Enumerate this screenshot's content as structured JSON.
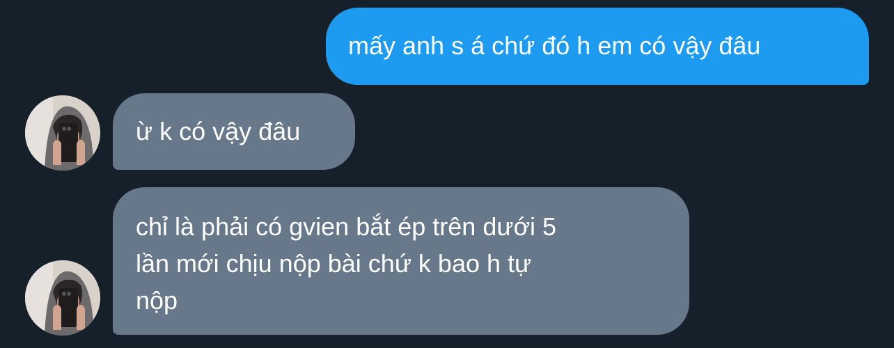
{
  "conversation": {
    "messages": [
      {
        "direction": "outgoing",
        "text": "mấy anh s á chứ đó h em có vậy đâu"
      },
      {
        "direction": "incoming",
        "text": "ừ k có vậy đâu"
      },
      {
        "direction": "incoming",
        "text": "chỉ là phải có gvien bắt ép trên dưới 5\nlần mới chịu nộp bài chứ k bao h tự\nnộp"
      }
    ]
  },
  "colors": {
    "background": "#15202b",
    "outgoing_bubble": "#1d9bf0",
    "incoming_bubble": "#66788a",
    "text": "#ffffff"
  },
  "icons": [
    "avatar-photo-icon"
  ]
}
